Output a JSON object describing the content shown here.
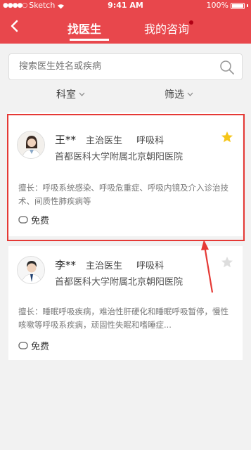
{
  "status_bar": {
    "carrier": "Sketch",
    "time": "9:41 AM",
    "battery": "100%"
  },
  "header": {
    "tabs": [
      {
        "label": "找医生"
      },
      {
        "label": "我的咨询"
      }
    ],
    "accent": "#e8474c"
  },
  "search": {
    "placeholder": "搜索医生姓名或疾病"
  },
  "filters": {
    "department": "科室",
    "screen": "筛选"
  },
  "doctors": [
    {
      "name": "王**",
      "title": "主治医生",
      "department": "呼吸科",
      "hospital": "首都医科大学附属北京朝阳医院",
      "specialty": "擅长：呼吸系统感染、呼吸危重症、呼吸内镜及介入诊治技术、间质性肺疾病等",
      "fee": "免费",
      "favorited": true
    },
    {
      "name": "李**",
      "title": "主治医生",
      "department": "呼吸科",
      "hospital": "首都医科大学附属北京朝阳医院",
      "specialty": "擅长：睡眠呼吸疾病，难治性肝硬化和睡眠呼吸暂停，慢性咳嗽等呼吸系疾病，顽固性失眠和嗜睡症...",
      "fee": "免费",
      "favorited": false
    }
  ],
  "colors": {
    "star_active": "#f5c518",
    "star_inactive": "#dddddd",
    "highlight": "#e53935"
  }
}
